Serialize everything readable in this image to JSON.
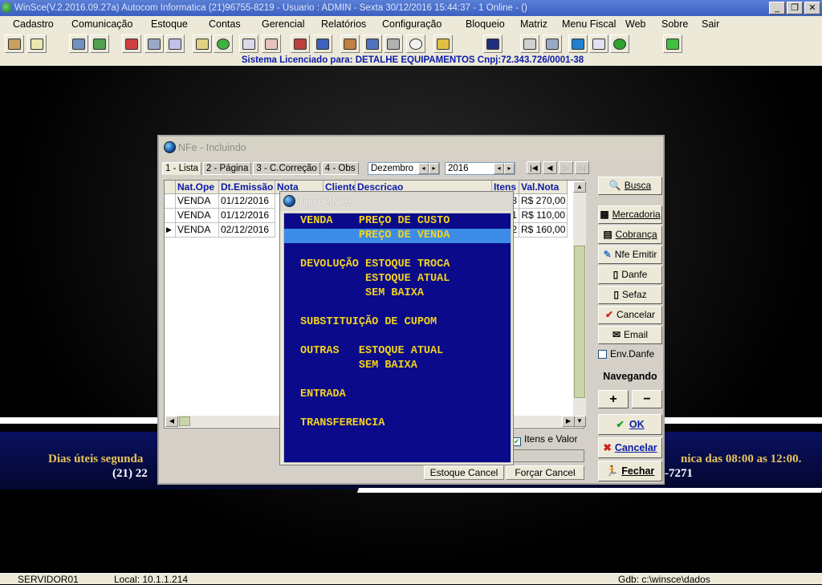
{
  "titlebar": {
    "text": "WinSce(V.2.2016.09.27a) Autocom Informatica (21)96755-8219 -  Usuario : ADMIN - Sexta 30/12/2016 15:44:37 - 1 Online - ()"
  },
  "menu": [
    "Cadastro",
    "Comunicação",
    "Estoque",
    "Contas",
    "Gerencial",
    "Relatórios",
    "Configuração",
    "Bloqueio",
    "Matriz",
    "Menu Fiscal",
    "Web",
    "Sobre",
    "Sair"
  ],
  "license": "Sistema Licenciado para: DETALHE EQUIPAMENTOS Cnpj:72.343.726/0001-38",
  "banner": {
    "line1a": "Dias úteis segunda",
    "line1b": "nica das 08:00 as 12:00.",
    "line2a": "(21)  22",
    "line2b": "-7271"
  },
  "status": {
    "server": "SERVIDOR01",
    "local": "Local: 10.1.1.214",
    "gdb": "Gdb: c:\\winsce\\dados"
  },
  "nfe": {
    "title": "NFe - Incluindo",
    "tabs": [
      "1 - Lista",
      "2 - Página",
      "3 - C.Correção",
      "4 - Obs"
    ],
    "month": "Dezembro",
    "year": "2016",
    "columns": [
      "Nat.Ope",
      "Dt.Emissão",
      "Nota",
      "Cliente",
      "Descricao",
      "Itens",
      "Val.Nota"
    ],
    "rows": [
      {
        "nat": "VENDA",
        "date": "01/12/2016",
        "itens": "3",
        "val": "R$ 270,00"
      },
      {
        "nat": "VENDA",
        "date": "01/12/2016",
        "itens": "1",
        "val": "R$ 110,00"
      },
      {
        "nat": "VENDA",
        "date": "02/12/2016",
        "itens": "2",
        "val": "R$ 160,00"
      }
    ],
    "buttons": {
      "busca": "Busca",
      "mercadoria": "Mercadoria",
      "cobranca": "Cobrança",
      "nfe_emitir": "Nfe Emitir",
      "danfe": "Danfe",
      "sefaz": "Sefaz",
      "cancelar": "Cancelar",
      "email": "Email",
      "env_danfe": "Env.Danfe",
      "navegando": "Navegando",
      "plus": "+",
      "minus": "−",
      "ok": "OK",
      "cancelar2": "Cancelar",
      "fechar": "Fechar"
    },
    "itens_valor": "Itens e Valor",
    "estoque_cancel": "Estoque Cancel",
    "forcar_cancel": "Forçar Cancel"
  },
  "dialog": {
    "title": "Tipo de NFe",
    "options": [
      "VENDA    PREÇO DE CUSTO",
      "         PREÇO DE VENDA",
      "DEVOLUÇÃO ESTOQUE TROCA",
      "          ESTOQUE ATUAL",
      "          SEM BAIXA",
      "SUBSTITUIÇÃO DE CUPOM",
      "OUTRAS   ESTOQUE ATUAL",
      "         SEM BAIXA",
      "ENTRADA",
      "TRANSFERENCIA"
    ],
    "selected_index": 1
  },
  "colors": {
    "dialog_bg": "#0a0a8a",
    "option_text": "#f2d21e",
    "highlight": "#3c8ce8",
    "header_text": "#0a1aa8"
  }
}
